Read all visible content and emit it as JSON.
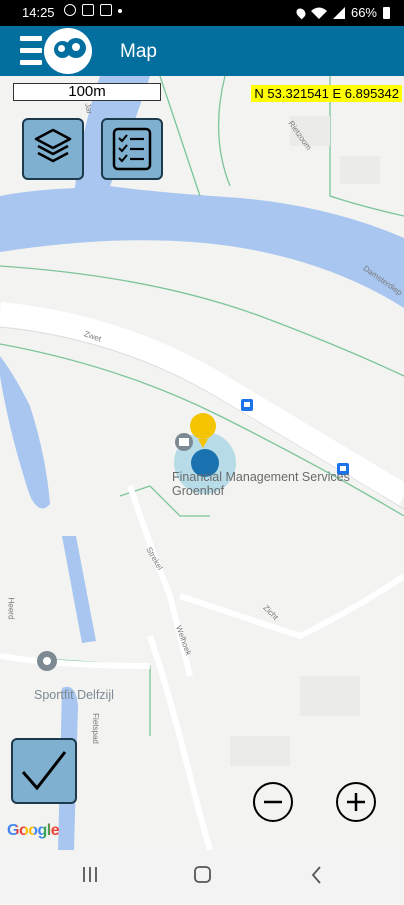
{
  "status_bar": {
    "time": "14:25",
    "battery": "66%",
    "icons_left": [
      "whatsapp-icon",
      "gallery-icon",
      "sim-icon",
      "dot-icon"
    ],
    "icons_right": [
      "location-icon",
      "wifi-icon",
      "signal-icon",
      "battery-icon"
    ]
  },
  "app_bar": {
    "title": "Map"
  },
  "map": {
    "scale_label": "100m",
    "coordinates": "N 53.321541 E 6.895342",
    "poi": {
      "business": "Financial Management Services Groenhof",
      "gym": "Sportfit Delfzijl"
    },
    "streets": {
      "rietzoom": "Rietzoom",
      "zwet": "Zwet",
      "damsterdiep": "Damsterdiep",
      "strekel": "Strekel",
      "welhoek": "Welhoek",
      "zicht": "Zicht",
      "heerd": "Heerd",
      "fietspad": "Fietspad",
      "jar": "Jar"
    },
    "attribution": "Google",
    "colors": {
      "water": "#a8c6f0",
      "land": "#f3f3f1",
      "road": "#ffffff",
      "park_line": "#7cc59a",
      "accent": "#036f9f",
      "location_dot": "#1a73b0",
      "selected_marker": "#f4c400"
    }
  },
  "controls": {
    "layers_icon": "layers-icon",
    "checklist_icon": "checklist-icon",
    "confirm_icon": "checkmark-icon",
    "zoom_out_icon": "minus-icon",
    "zoom_in_icon": "plus-icon"
  },
  "nav_bar": {
    "buttons": [
      "recents-icon",
      "home-icon",
      "back-icon"
    ]
  }
}
